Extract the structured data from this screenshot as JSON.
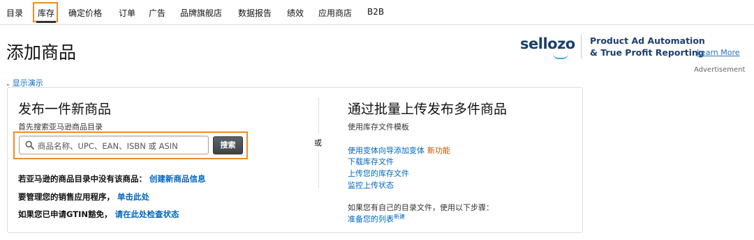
{
  "nav": {
    "items": [
      {
        "label": "目录"
      },
      {
        "label": "库存"
      },
      {
        "label": "确定价格"
      },
      {
        "label": "订单"
      },
      {
        "label": "广告"
      },
      {
        "label": "品牌旗舰店"
      },
      {
        "label": "数据报告"
      },
      {
        "label": "绩效"
      },
      {
        "label": "应用商店"
      },
      {
        "label": "B2B"
      }
    ],
    "active_index": 1,
    "highlight_color": "#f08a24"
  },
  "page": {
    "title": "添加商品"
  },
  "ad": {
    "logo_text": "sellozo",
    "line1": "Product Ad Automation",
    "line2": "& True Profit Reporting",
    "learn_more": "Learn More",
    "label": "Advertisement",
    "brand_color": "#1c3f6b",
    "accent_color": "#3ba7dd"
  },
  "demo": {
    "label": "显示演示",
    "icon": "chevron-down-icon"
  },
  "single": {
    "title": "发布一件新商品",
    "subtitle": "首先搜索亚马逊商品目录",
    "search_placeholder": "商品名称、UPC、EAN、ISBN 或 ASIN",
    "search_button": "搜索",
    "rows": [
      {
        "text": "若亚马逊的商品目录中没有该商品：",
        "link": "创建新商品信息"
      },
      {
        "text": "要管理您的销售应用程序，",
        "link": "单击此处"
      },
      {
        "text": "如果您已申请GTIN豁免，",
        "link": "请在此处检查状态"
      }
    ]
  },
  "divider": {
    "or_label": "或"
  },
  "bulk": {
    "title": "通过批量上传发布多件商品",
    "subtitle": "使用库存文件模板",
    "links": [
      {
        "label": "使用变体向导添加变体",
        "badge": "新功能"
      },
      {
        "label": "下载库存文件",
        "badge": ""
      },
      {
        "label": "上传您的库存文件",
        "badge": ""
      },
      {
        "label": "监控上传状态",
        "badge": ""
      }
    ],
    "note": "如果您有自己的目录文件，使用以下步骤：",
    "prepare_link": "准备您的列表",
    "prepare_badge": "新建"
  },
  "colors": {
    "link": "#0066c0",
    "badge": "#c45500"
  }
}
